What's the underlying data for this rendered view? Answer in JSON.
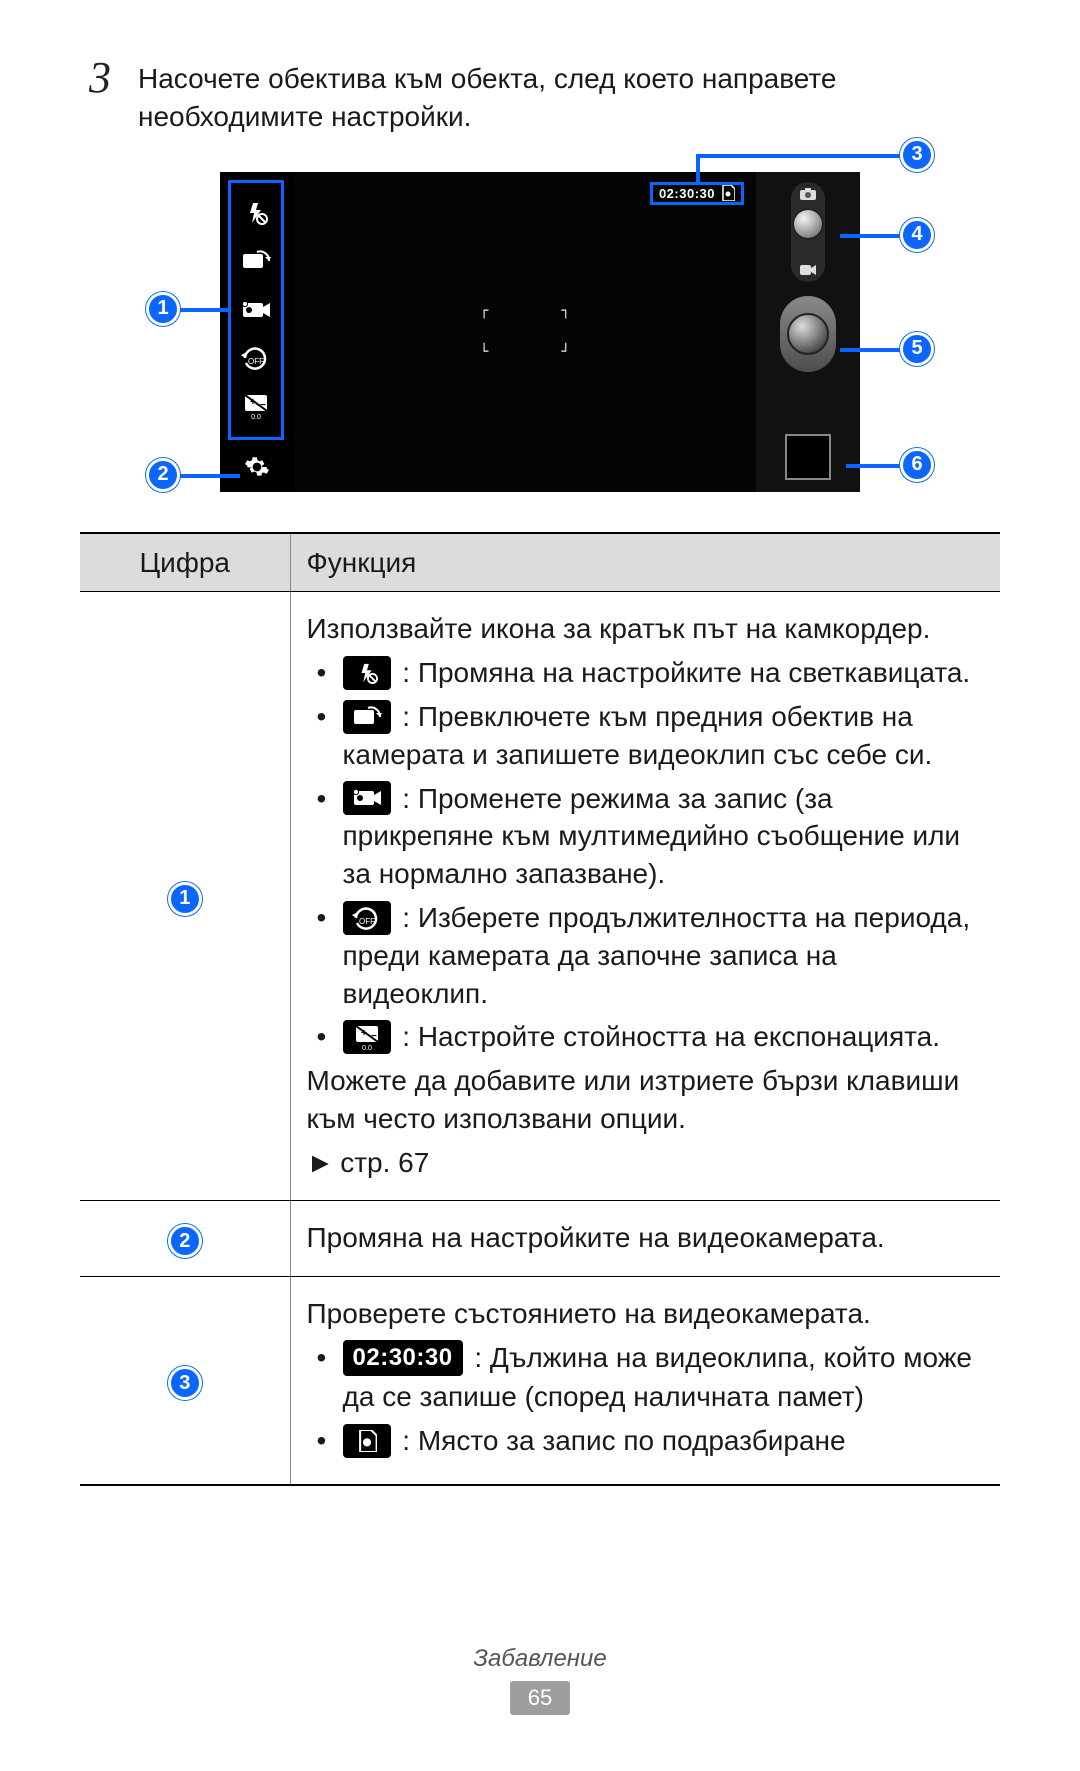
{
  "step": {
    "number": "3",
    "text": "Насочете обектива към обекта, след което направете необходимите настройки."
  },
  "camera": {
    "timer": "02:30:30"
  },
  "callouts": {
    "c1": "1",
    "c2": "2",
    "c3": "3",
    "c4": "4",
    "c5": "5",
    "c6": "6"
  },
  "table": {
    "header": {
      "col1": "Цифра",
      "col2": "Функция"
    },
    "row1": {
      "num": "1",
      "intro": "Използвайте икона за кратък път на камкордер.",
      "b1": " : Промяна на настройките на светкавицата.",
      "b2": " : Превключете към предния обектив на камерата и запишете видеоклип със себе си.",
      "b3": " : Променете режима за запис (за прикрепяне към мултимедийно съобщение или за нормално запазване).",
      "b4": " : Изберете продължителността на периода, преди камерата да започне записа на видеоклип.",
      "b5": " : Настройте стойността на експонацията.",
      "outro": "Можете да добавите или изтриете бързи клавиши към често използвани опции.",
      "pageref": "стр. 67"
    },
    "row2": {
      "num": "2",
      "text": "Промяна на настройките на видеокамерата."
    },
    "row3": {
      "num": "3",
      "intro": "Проверете състоянието на видеокамерата.",
      "timer": "02:30:30",
      "b1_tail": " : Дължина на видеоклипа, който може да се запише (според наличната памет)",
      "b2": " : Място за запис по подразбиране"
    }
  },
  "footer": {
    "section": "Забавление",
    "page": "65"
  }
}
